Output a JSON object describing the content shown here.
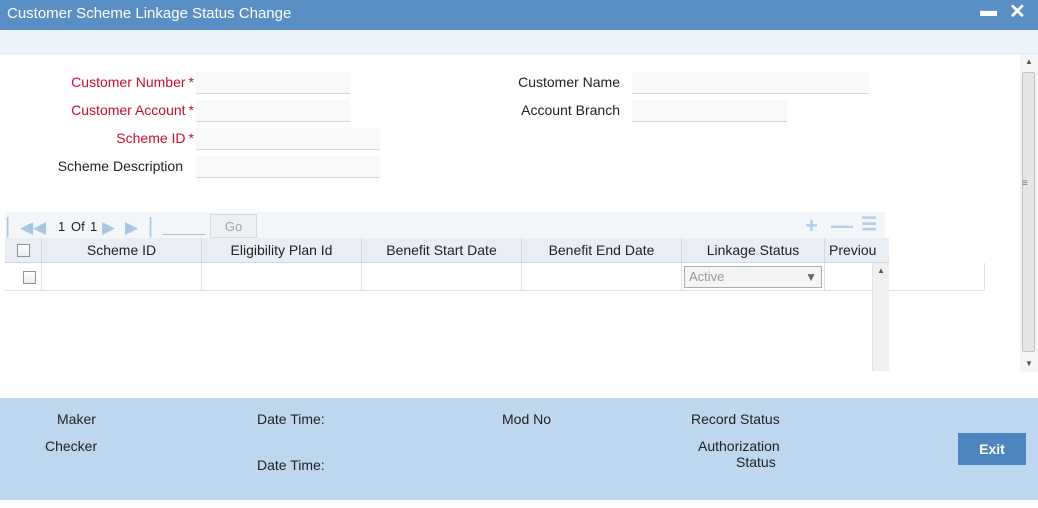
{
  "window": {
    "title": "Customer Scheme Linkage Status Change",
    "minimize": "▬",
    "close": "✕"
  },
  "form": {
    "customer_number": {
      "label": "Customer Number",
      "required_mark": "*",
      "value": ""
    },
    "customer_account": {
      "label": "Customer Account",
      "required_mark": "*",
      "value": ""
    },
    "scheme_id": {
      "label": "Scheme ID",
      "required_mark": "*",
      "value": ""
    },
    "scheme_description": {
      "label": "Scheme Description",
      "value": ""
    },
    "customer_name": {
      "label": "Customer Name",
      "value": ""
    },
    "account_branch": {
      "label": "Account Branch",
      "value": ""
    }
  },
  "pager": {
    "current_page": "1",
    "of_label": "Of",
    "total_pages": "1",
    "go_label": "Go",
    "icons": {
      "first": "first-page-icon",
      "prev": "previous-page-icon",
      "next": "next-page-icon",
      "last": "last-page-icon",
      "add": "add-row-icon",
      "delete": "delete-row-icon",
      "single_view": "single-record-view-icon"
    }
  },
  "grid": {
    "columns": [
      "Scheme ID",
      "Eligibility Plan Id",
      "Benefit Start Date",
      "Benefit End Date",
      "Linkage Status",
      "Previou"
    ],
    "rows": [
      {
        "scheme_id": "",
        "eligibility_plan_id": "",
        "benefit_start_date": "",
        "benefit_end_date": "",
        "linkage_status": "Active",
        "previous": ""
      }
    ]
  },
  "footer": {
    "maker": "Maker",
    "checker": "Checker",
    "date_time_1": "Date Time:",
    "date_time_2": "Date Time:",
    "mod_no": "Mod No",
    "record_status": "Record Status",
    "authorization": "Authorization",
    "authorization_status": "Status",
    "exit": "Exit"
  },
  "colors": {
    "title_bar": "#5a8fc5",
    "required_label": "#c8102e",
    "footer": "#bcd7ee",
    "exit_button": "#4f86bf"
  }
}
